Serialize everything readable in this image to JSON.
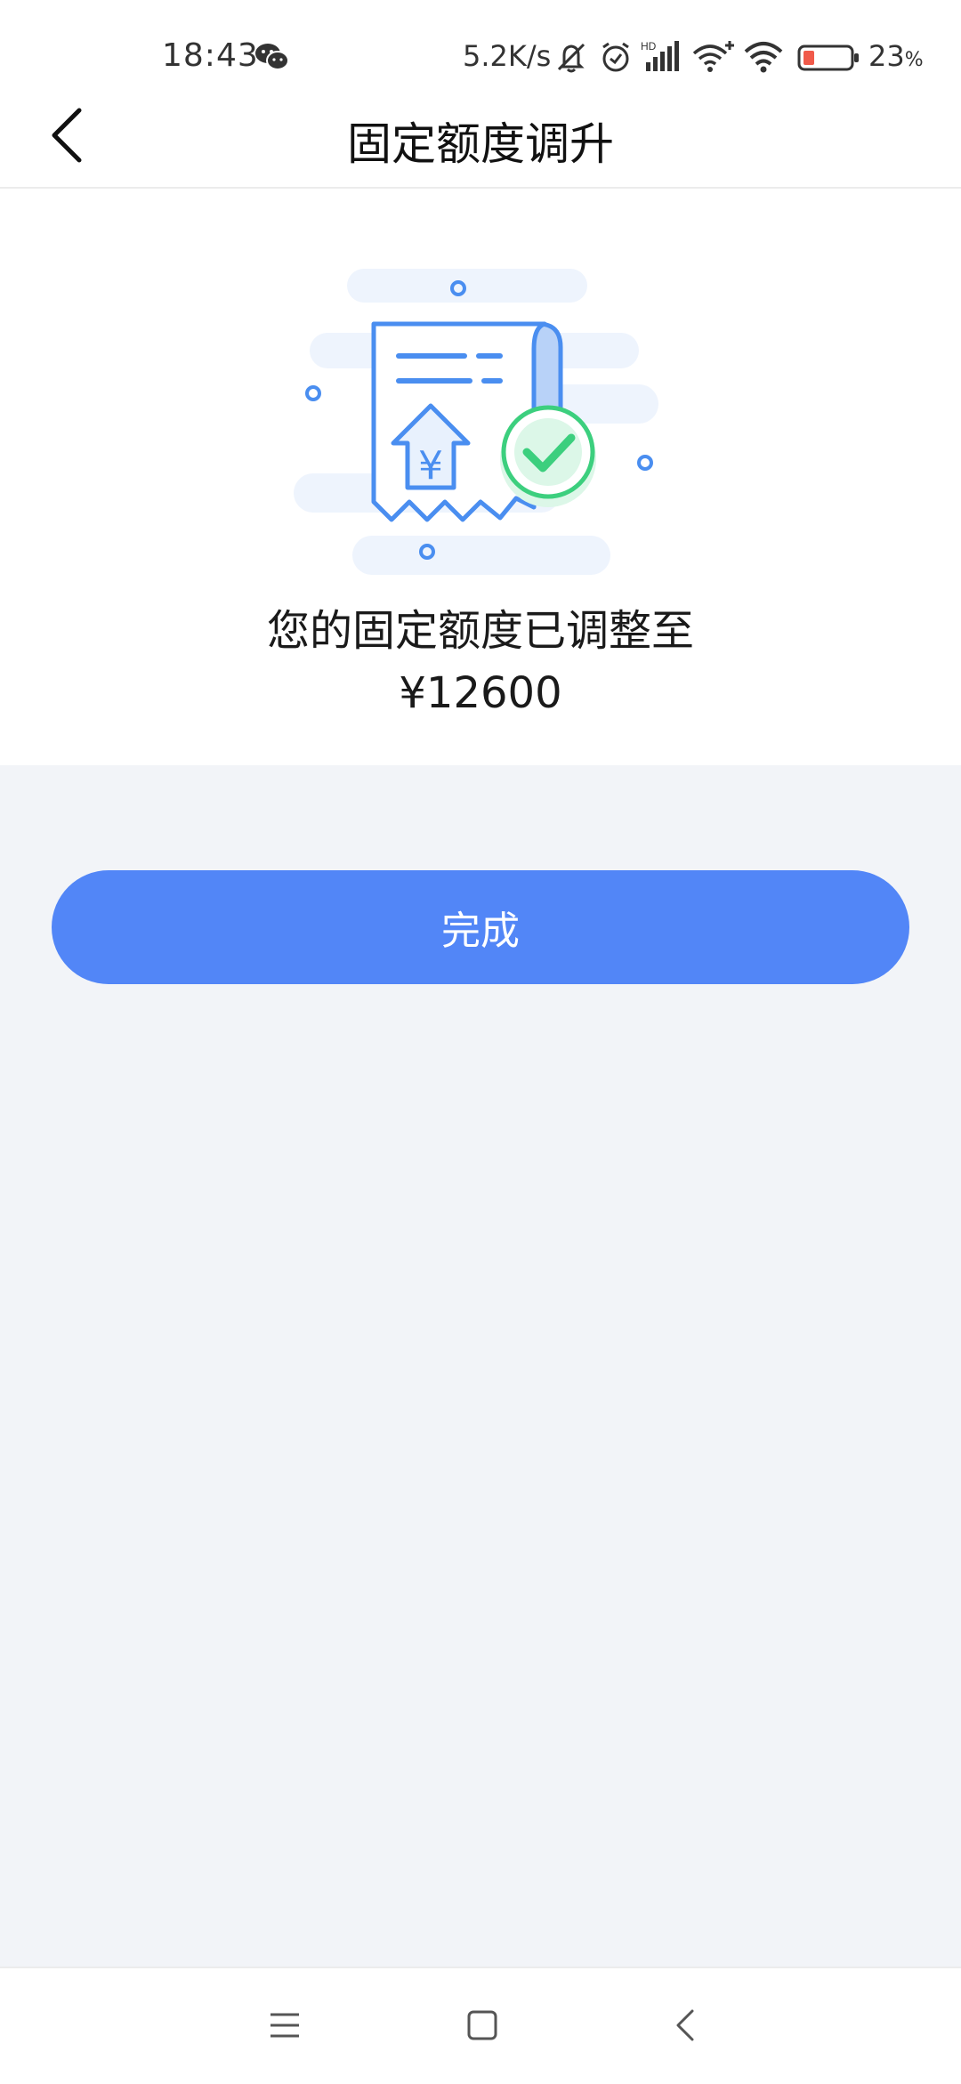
{
  "status_bar": {
    "time": "18:43",
    "net_speed": "5.2K/s",
    "battery_percent": "23",
    "battery_unit": "%",
    "icons": [
      "wechat-icon",
      "mute-icon",
      "alarm-icon",
      "hd-signal-icon",
      "wifi-plus-icon",
      "wifi-icon",
      "battery-icon"
    ]
  },
  "header": {
    "title": "固定额度调升",
    "back_icon": "chevron-left-icon"
  },
  "result": {
    "illustration_icon": "receipt-check-icon",
    "message": "您的固定额度已调整至",
    "amount": "¥12600"
  },
  "actions": {
    "done_label": "完成"
  },
  "bottom_nav": {
    "icons": [
      "menu-icon",
      "home-icon",
      "back-icon"
    ]
  },
  "colors": {
    "accent": "#5286f7",
    "illustration_blue": "#4a8ef0",
    "success_green": "#3ccf7e",
    "page_bg": "#f2f4f8"
  }
}
